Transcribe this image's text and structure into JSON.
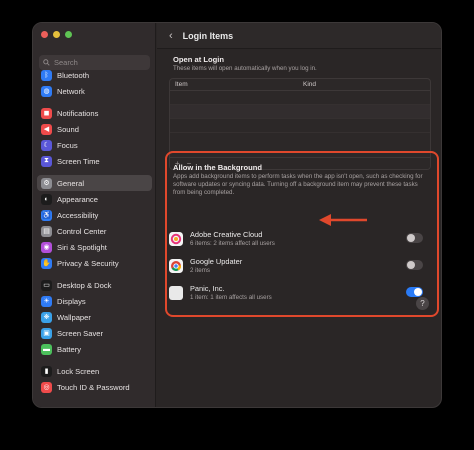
{
  "window": {
    "title": "Login Items",
    "back_label": "‹"
  },
  "search": {
    "placeholder": "Search"
  },
  "sidebar": {
    "items": [
      {
        "label": "Bluetooth",
        "color": "#2f7bf5",
        "icon": "bluetooth-icon",
        "glyph": "ᛒ"
      },
      {
        "label": "Network",
        "color": "#2f7bf5",
        "icon": "globe-icon",
        "glyph": "◍"
      },
      {
        "label": "Notifications",
        "color": "#ef4b4b",
        "icon": "bell-icon",
        "glyph": "◼"
      },
      {
        "label": "Sound",
        "color": "#ef4b4b",
        "icon": "speaker-icon",
        "glyph": "◀"
      },
      {
        "label": "Focus",
        "color": "#5a57d8",
        "icon": "moon-icon",
        "glyph": "☾"
      },
      {
        "label": "Screen Time",
        "color": "#5a57d8",
        "icon": "hourglass-icon",
        "glyph": "⧗"
      },
      {
        "label": "General",
        "color": "#8d8d92",
        "icon": "gear-icon",
        "glyph": "⚙",
        "selected": true
      },
      {
        "label": "Appearance",
        "color": "#1c1c1c",
        "icon": "appearance-icon",
        "glyph": "◐"
      },
      {
        "label": "Accessibility",
        "color": "#2f7bf5",
        "icon": "accessibility-icon",
        "glyph": "♿"
      },
      {
        "label": "Control Center",
        "color": "#8d8d92",
        "icon": "control-center-icon",
        "glyph": "▤"
      },
      {
        "label": "Siri & Spotlight",
        "color": "#b24fd9",
        "icon": "siri-icon",
        "glyph": "◉"
      },
      {
        "label": "Privacy & Security",
        "color": "#2f7bf5",
        "icon": "hand-icon",
        "glyph": "✋"
      },
      {
        "label": "Desktop & Dock",
        "color": "#1c1c1c",
        "icon": "dock-icon",
        "glyph": "▭"
      },
      {
        "label": "Displays",
        "color": "#2f7bf5",
        "icon": "display-icon",
        "glyph": "☀"
      },
      {
        "label": "Wallpaper",
        "color": "#3aa1e8",
        "icon": "wallpaper-icon",
        "glyph": "❋"
      },
      {
        "label": "Screen Saver",
        "color": "#3aa1e8",
        "icon": "screensaver-icon",
        "glyph": "▣"
      },
      {
        "label": "Battery",
        "color": "#4cc05c",
        "icon": "battery-icon",
        "glyph": "▬"
      },
      {
        "label": "Lock Screen",
        "color": "#1c1c1c",
        "icon": "lock-icon",
        "glyph": "▮"
      },
      {
        "label": "Touch ID & Password",
        "color": "#ef4b4b",
        "icon": "fingerprint-icon",
        "glyph": "◎"
      }
    ]
  },
  "open_at_login": {
    "title": "Open at Login",
    "subtitle": "These items will open automatically when you log in.",
    "columns": {
      "item": "Item",
      "kind": "Kind"
    },
    "add_label": "+",
    "remove_label": "−"
  },
  "background": {
    "title": "Allow in the Background",
    "description": "Apps add background items to perform tasks when the app isn't open, such as checking for software updates or syncing data. Turning off a background item may prevent these tasks from being completed.",
    "items": [
      {
        "name": "Adobe Creative Cloud",
        "meta": "6 items: 2 items affect all users",
        "enabled": false,
        "icon": "creative-cloud-icon"
      },
      {
        "name": "Google Updater",
        "meta": "2 items",
        "enabled": false,
        "icon": "chrome-icon"
      },
      {
        "name": "Panic, Inc.",
        "meta": "1 item: 1 item affects all users",
        "enabled": true,
        "icon": "panic-icon"
      }
    ]
  },
  "help_label": "?"
}
